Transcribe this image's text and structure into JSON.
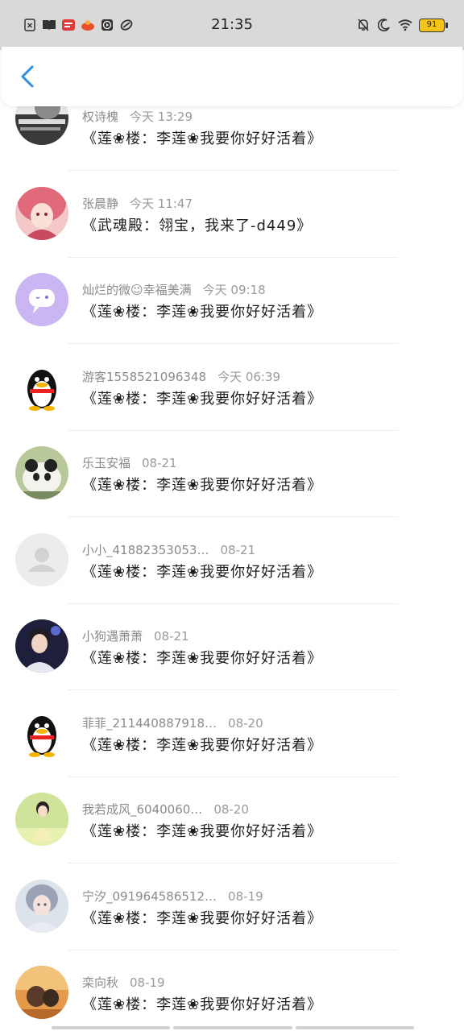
{
  "status_bar": {
    "time": "21:35",
    "battery": "91",
    "left_icons": [
      "close-box-icon",
      "book-icon",
      "news-app-icon",
      "food-app-icon",
      "play-box-icon",
      "link-icon"
    ],
    "right_icons": [
      "mute-bell-icon",
      "moon-icon",
      "wifi-icon",
      "battery-icon"
    ]
  },
  "header": {
    "back_icon": "chevron-left-icon",
    "accent": "#2e8fe0"
  },
  "comments": [
    {
      "name": "权诗槐",
      "time": "今天 13:29",
      "message": "《莲❀楼：李莲❀我要你好好活着》",
      "avatar": "photo-text"
    },
    {
      "name": "张晨静",
      "time": "今天 11:47",
      "message": "《武魂殿：翎宝，我来了-d449》",
      "avatar": "anime-girl"
    },
    {
      "name": "灿烂的微☺幸福美满",
      "time": "今天 09:18",
      "message": "《莲❀楼：李莲❀我要你好好活着》",
      "avatar": "purple-chat"
    },
    {
      "name": "游客1558521096348",
      "time": "今天 06:39",
      "message": "《莲❀楼：李莲❀我要你好好活着》",
      "avatar": "penguin"
    },
    {
      "name": "乐玉安福",
      "time": "08-21",
      "message": "《莲❀楼：李莲❀我要你好好活着》",
      "avatar": "panda"
    },
    {
      "name": "小小_41882353053…",
      "time": "08-21",
      "message": "《莲❀楼：李莲❀我要你好好活着》",
      "avatar": "default-person"
    },
    {
      "name": "小狗遇萧萧",
      "time": "08-21",
      "message": "《莲❀楼：李莲❀我要你好好活着》",
      "avatar": "young-man"
    },
    {
      "name": "菲菲_211440887918…",
      "time": "08-20",
      "message": "《莲❀楼：李莲❀我要你好好活着》",
      "avatar": "penguin"
    },
    {
      "name": "我若成风_6040060…",
      "time": "08-20",
      "message": "《莲❀楼：李莲❀我要你好好活着》",
      "avatar": "girl-outdoor"
    },
    {
      "name": "宁汐_091964586512…",
      "time": "08-19",
      "message": "《莲❀楼：李莲❀我要你好好活着》",
      "avatar": "anime-white"
    },
    {
      "name": "栾向秋",
      "time": "08-19",
      "message": "《莲❀楼：李莲❀我要你好好活着》",
      "avatar": "sunset-photo"
    }
  ]
}
